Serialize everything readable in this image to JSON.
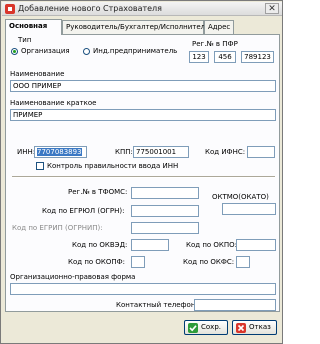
{
  "window": {
    "title": "Добавление нового Страхователя",
    "close_glyph": "✕"
  },
  "tabs": [
    {
      "label": "Основная",
      "active": true
    },
    {
      "label": "Руководитель/Бухгалтер/Исполнитель",
      "active": false
    },
    {
      "label": "Адрес",
      "active": false
    }
  ],
  "type_section": {
    "label": "Тип",
    "options": [
      {
        "label": "Организация",
        "selected": true
      },
      {
        "label": "Инд.предприниматель",
        "selected": false
      }
    ]
  },
  "pfr": {
    "label": "Рег.№ в ПФР",
    "parts": [
      "123",
      "456",
      "789123"
    ]
  },
  "name": {
    "label": "Наименование",
    "value": "ООО ПРИМЕР"
  },
  "short_name": {
    "label": "Наименование краткое",
    "value": "ПРИМЕР"
  },
  "inn": {
    "label": "ИНН:",
    "value": "7707083893"
  },
  "kpp": {
    "label": "КПП:",
    "value": "775001001"
  },
  "ifns": {
    "label": "Код ИФНС:",
    "value": ""
  },
  "inn_check": {
    "label": "Контроль правильности ввода ИНН",
    "checked": false
  },
  "tfoms": {
    "label": "Рег.№ в ТФОМС:",
    "value": ""
  },
  "oktmo": {
    "label": "ОКТМО(ОКАТО)",
    "value": ""
  },
  "egrul": {
    "label": "Код по ЕГРЮЛ (ОГРН):",
    "value": ""
  },
  "egrip": {
    "label": "Код по ЕГРИП (ОГРНИП):",
    "value": ""
  },
  "okved": {
    "label": "Код по ОКВЭД:",
    "value": ""
  },
  "okpo": {
    "label": "Код по ОКПО:",
    "value": ""
  },
  "okopf": {
    "label": "Код по ОКОПФ:",
    "value": ""
  },
  "okfs": {
    "label": "Код по ОКФС:",
    "value": ""
  },
  "legal_form": {
    "label": "Организационно-правовая форма",
    "value": ""
  },
  "phone": {
    "label": "Контактный телефон:",
    "value": ""
  },
  "buttons": {
    "save": "Сохр.",
    "cancel": "Отказ"
  }
}
